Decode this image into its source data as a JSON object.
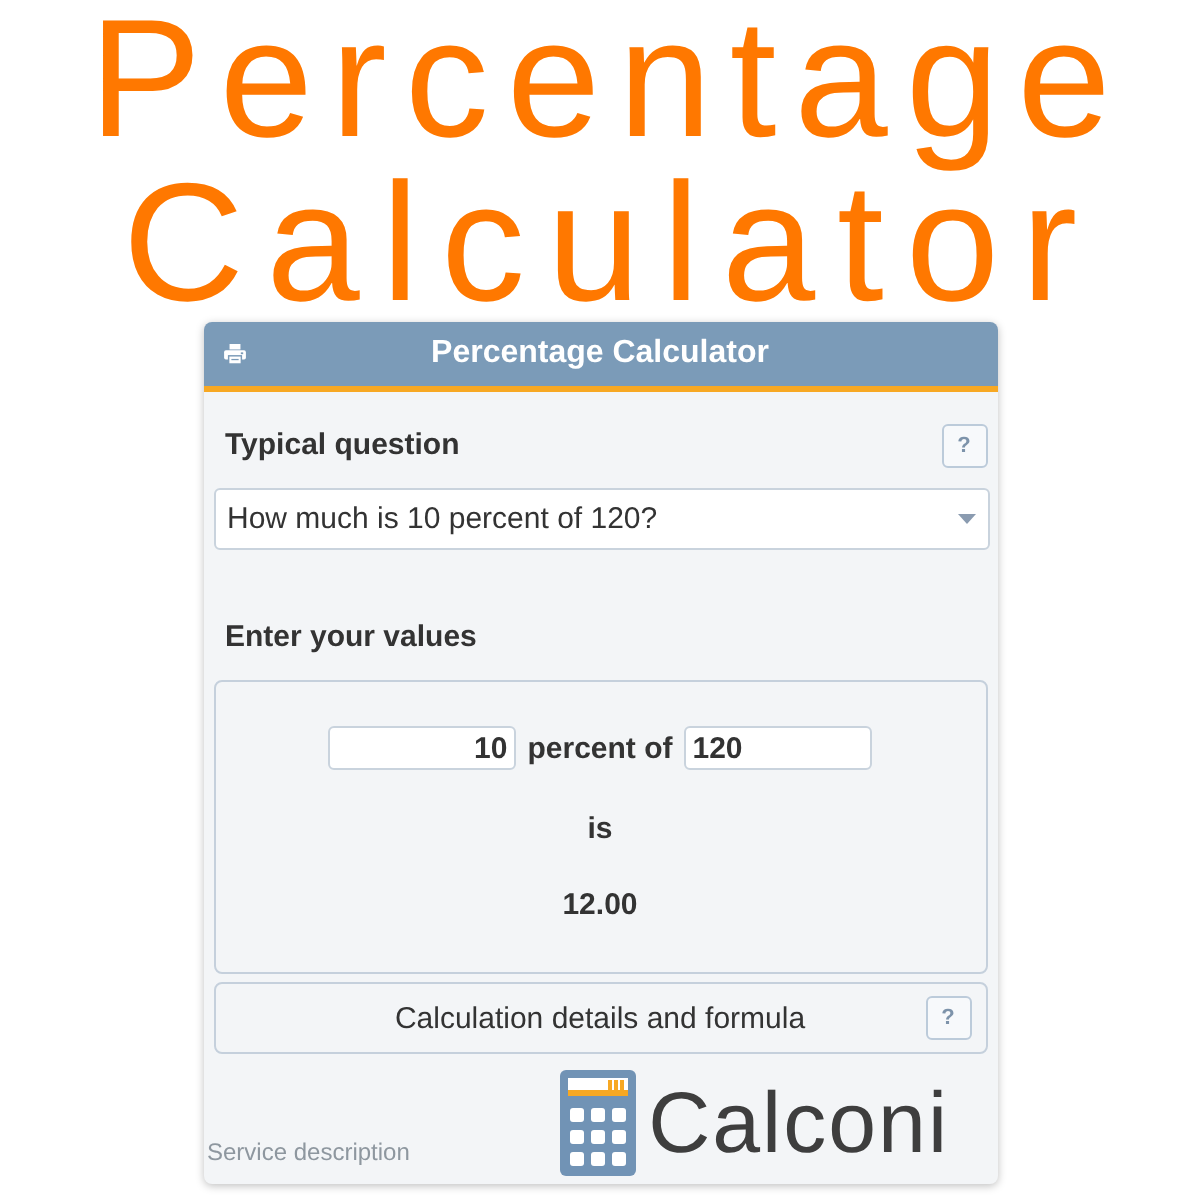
{
  "banner": {
    "lines": [
      "Percentage",
      "Calculator"
    ]
  },
  "panel": {
    "title": "Percentage Calculator",
    "question": {
      "label": "Typical question",
      "help": "?",
      "value": "How much is 10 percent of 120?"
    },
    "values": {
      "heading": "Enter your values",
      "percent_field": {
        "value": "10"
      },
      "connector": "percent of",
      "base_field": {
        "value": "120"
      },
      "result_label": "is",
      "result": "12.00"
    },
    "details": {
      "label": "Calculation details and formula",
      "help": "?"
    },
    "footer": {
      "link": "Service description",
      "logo_text": "Calconi"
    }
  }
}
